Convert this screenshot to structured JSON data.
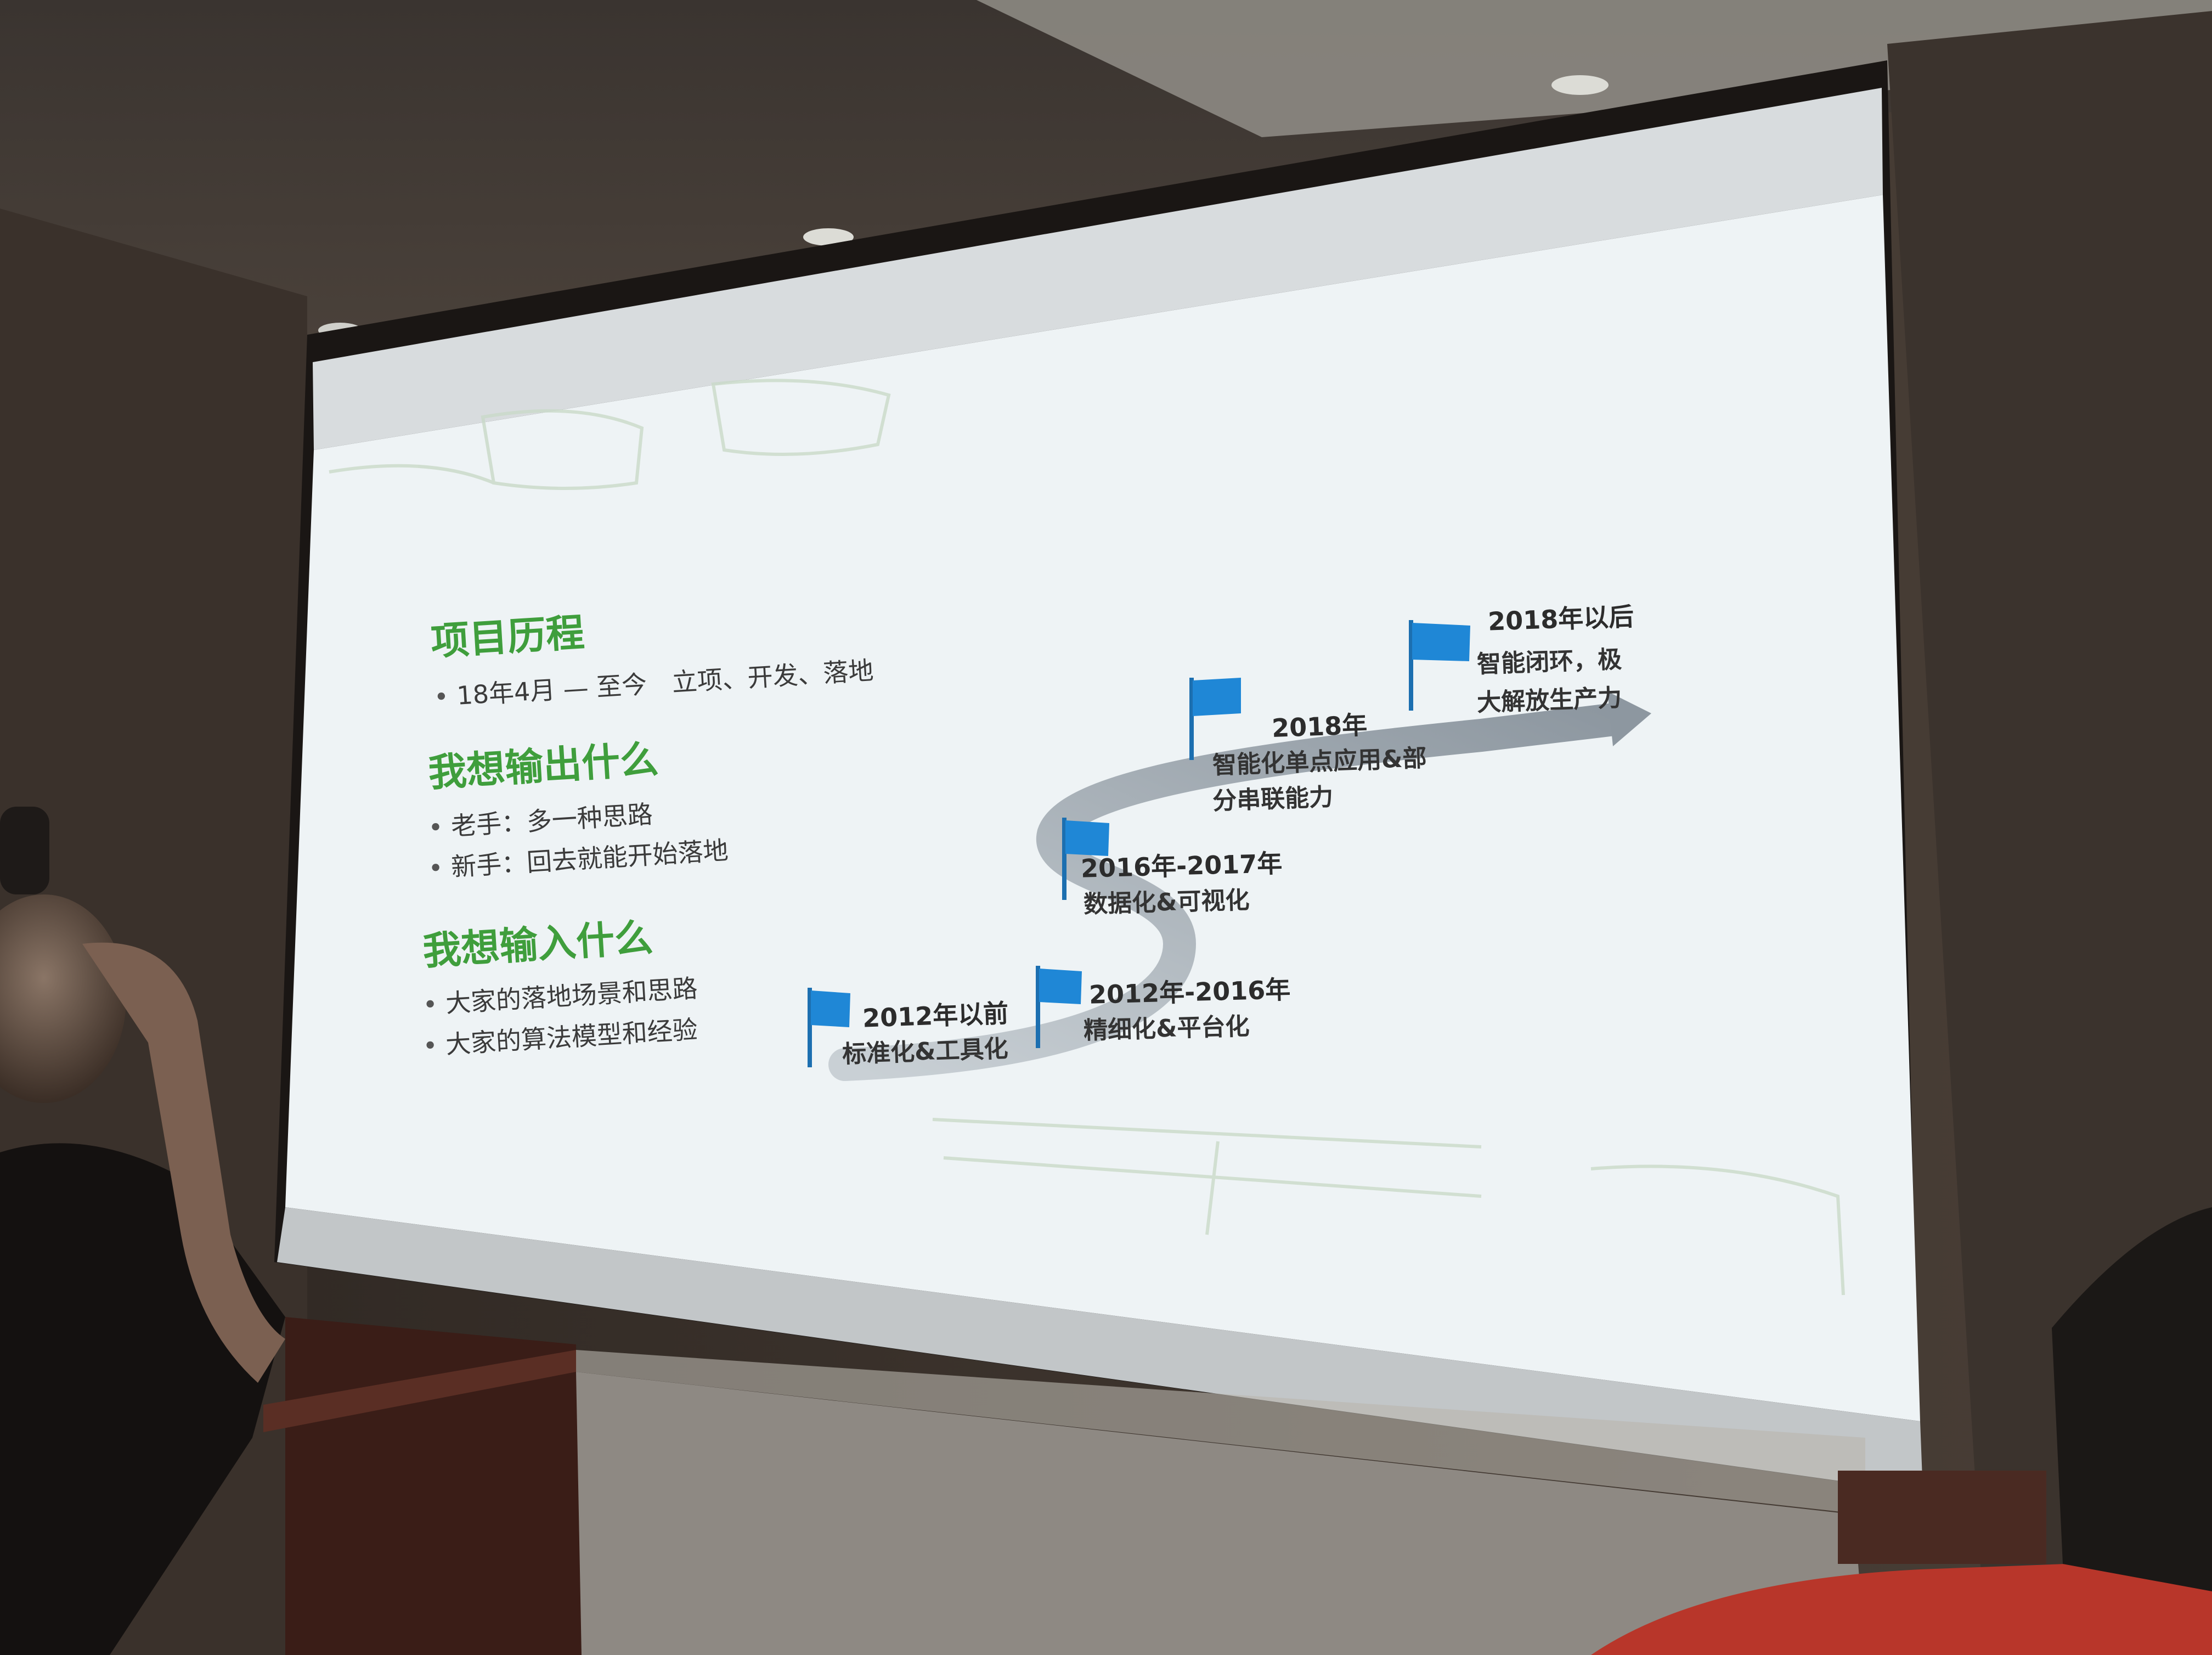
{
  "slide": {
    "sections": [
      {
        "heading": "项目历程",
        "bullets": [
          "18年4月 — 至今　立项、开发、落地"
        ]
      },
      {
        "heading": "我想输出什么",
        "bullets": [
          "老手：多一种思路",
          "新手：回去就能开始落地"
        ]
      },
      {
        "heading": "我想输入什么",
        "bullets": [
          "大家的落地场景和思路",
          "大家的算法模型和经验"
        ]
      }
    ],
    "timeline": {
      "milestones": [
        {
          "label": "2012年以前",
          "desc": [
            "标准化&工具化"
          ]
        },
        {
          "label": "2012年-2016年",
          "desc": [
            "精细化&平台化"
          ]
        },
        {
          "label": "2016年-2017年",
          "desc": [
            "数据化&可视化"
          ]
        },
        {
          "label": "2018年",
          "desc": [
            "智能化单点应用&部",
            "分串联能力"
          ]
        },
        {
          "label": "2018年以后",
          "desc": [
            "智能闭环，极",
            "大解放生产力"
          ]
        }
      ]
    }
  },
  "colors": {
    "heading_green": "#3f9e3c",
    "flag_blue": "#1f87d6",
    "arrow_grey": "#9aa4ad",
    "screen": "#eef3f5"
  }
}
